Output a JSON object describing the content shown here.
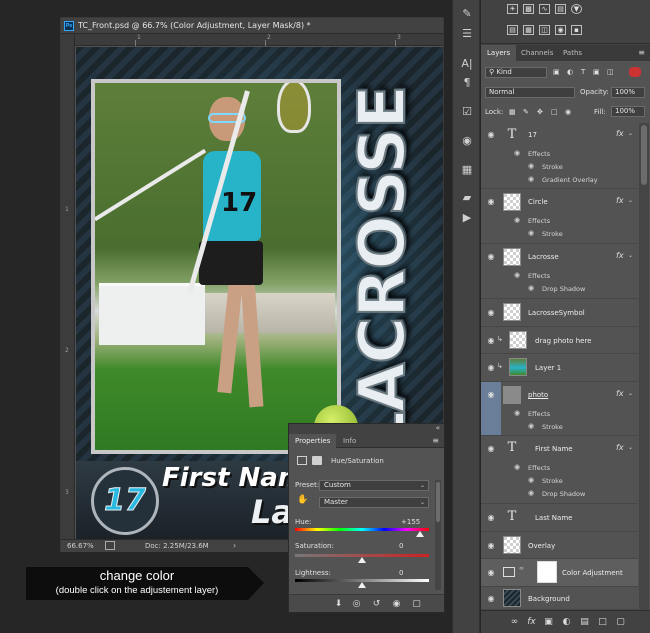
{
  "document": {
    "title": "TC_Front.psd @ 66.7% (Color Adjustment, Layer Mask/8) *",
    "ps_badge": "Ps",
    "zoom": "66.67%",
    "doc_size": "Doc: 2.25M/23.6M",
    "ruler_top": [
      "1",
      "2",
      "3"
    ],
    "ruler_left": [
      "1",
      "2",
      "3"
    ]
  },
  "card": {
    "vertical_title": "LACROSSE",
    "jersey_number": "17",
    "badge_number": "17",
    "first_name": "First Name",
    "last_name": "Las"
  },
  "properties": {
    "tabs": [
      "Properties",
      "Info"
    ],
    "panel_title": "Hue/Saturation",
    "preset_label": "Preset:",
    "preset_value": "Custom",
    "channel_value": "Master",
    "hue_label": "Hue:",
    "hue_value": "+155",
    "saturation_label": "Saturation:",
    "saturation_value": "0",
    "lightness_label": "Lightness:",
    "lightness_value": "0",
    "hue_level": 0.93,
    "saturation_level": 0.5,
    "lightness_level": 0.5
  },
  "callout": {
    "line1": "change color",
    "line2": "(double click on the adjustement layer)"
  },
  "layers_panel": {
    "tabs": [
      "Layers",
      "Channels",
      "Paths"
    ],
    "filter_value": "Kind",
    "blend_mode": "Normal",
    "opacity_label": "Opacity:",
    "opacity_value": "100%",
    "lock_label": "Lock:",
    "fill_label": "Fill:",
    "fill_value": "100%",
    "effects_label": "Effects",
    "layers": [
      {
        "name": "17",
        "kind": "text",
        "fx": true,
        "effects": [
          "Stroke",
          "Gradient Overlay"
        ]
      },
      {
        "name": "Circle",
        "kind": "pixel",
        "fx": true,
        "effects": [
          "Stroke"
        ]
      },
      {
        "name": "Lacrosse",
        "kind": "pixel",
        "fx": true,
        "effects": [
          "Drop Shadow"
        ]
      },
      {
        "name": "LacrosseSymbol",
        "kind": "pixel",
        "fx": false,
        "effects": []
      },
      {
        "name": "drag photo here",
        "kind": "pixel",
        "fx": false,
        "effects": []
      },
      {
        "name": "Layer 1",
        "kind": "photo",
        "fx": false,
        "effects": []
      },
      {
        "name": "photo",
        "kind": "pixel",
        "fx": true,
        "effects": [
          "Stroke"
        ],
        "selected": true
      },
      {
        "name": "First Name",
        "kind": "text",
        "fx": true,
        "effects": [
          "Stroke",
          "Drop Shadow"
        ]
      },
      {
        "name": "Last Name",
        "kind": "text",
        "fx": false,
        "effects": []
      },
      {
        "name": "Overlay",
        "kind": "pixel",
        "fx": false,
        "effects": []
      },
      {
        "name": "Color Adjustment",
        "kind": "adjustment",
        "fx": false,
        "effects": []
      },
      {
        "name": "Background",
        "kind": "background",
        "fx": false,
        "effects": []
      }
    ]
  },
  "icons": {
    "eye": "eye-icon",
    "menu": "panel-menu-icon"
  }
}
